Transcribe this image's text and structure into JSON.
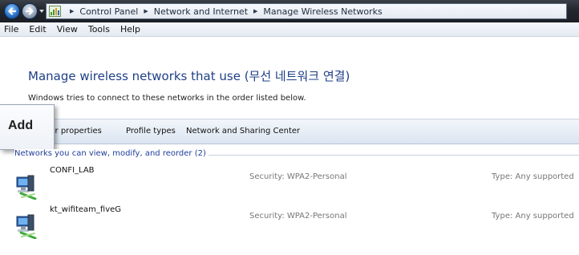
{
  "address_bar": {
    "crumbs": [
      "Control Panel",
      "Network and Internet",
      "Manage Wireless Networks"
    ]
  },
  "menu": [
    "File",
    "Edit",
    "View",
    "Tools",
    "Help"
  ],
  "header": {
    "title": "Manage wireless networks that use (무선 네트워크 연결)",
    "description": "Windows tries to connect to these networks in the order listed below."
  },
  "toolbar": {
    "add_label": "Add",
    "adapter_label": "Adapter properties",
    "adapter_visible_label": "apter properties",
    "profile_types_label": "Profile types",
    "sharing_center_label": "Network and Sharing Center"
  },
  "group": {
    "label": "Networks you can view, modify, and reorder (2)"
  },
  "networks": [
    {
      "name": "CONFI_LAB",
      "security": "Security:  WPA2-Personal",
      "type": "Type:  Any supported"
    },
    {
      "name": "kt_wifiteam_fiveG",
      "security": "Security:  WPA2-Personal",
      "type": "Type:  Any supported"
    }
  ],
  "colors": {
    "title": "#1e3f87",
    "group_label": "#1e3f9a",
    "address_bar": "#23272e"
  },
  "icons": {
    "back": "back-arrow-icon",
    "forward": "forward-arrow-icon",
    "control_panel": "control-panel-icon",
    "network": "wireless-network-icon"
  }
}
